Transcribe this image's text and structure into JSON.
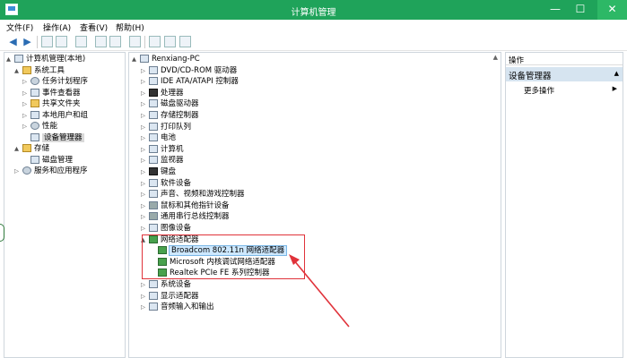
{
  "window": {
    "title": "计算机管理",
    "controls": {
      "minimize": "—",
      "maximize": "☐",
      "close": "✕"
    }
  },
  "menu": [
    "文件(F)",
    "操作(A)",
    "查看(V)",
    "帮助(H)"
  ],
  "left_tree": [
    {
      "label": "计算机管理(本地)",
      "indent": 0,
      "expander": "▲",
      "icon": "computer-icon"
    },
    {
      "label": "系统工具",
      "indent": 1,
      "expander": "▲",
      "icon": "tools-icon"
    },
    {
      "label": "任务计划程序",
      "indent": 2,
      "expander": "▷",
      "icon": "clock-icon"
    },
    {
      "label": "事件查看器",
      "indent": 2,
      "expander": "▷",
      "icon": "event-viewer-icon"
    },
    {
      "label": "共享文件夹",
      "indent": 2,
      "expander": "▷",
      "icon": "folder-icon"
    },
    {
      "label": "本地用户和组",
      "indent": 2,
      "expander": "▷",
      "icon": "users-icon"
    },
    {
      "label": "性能",
      "indent": 2,
      "expander": "▷",
      "icon": "performance-icon"
    },
    {
      "label": "设备管理器",
      "indent": 2,
      "expander": "",
      "icon": "device-manager-icon",
      "selected": true
    },
    {
      "label": "存储",
      "indent": 1,
      "expander": "▲",
      "icon": "storage-icon"
    },
    {
      "label": "磁盘管理",
      "indent": 2,
      "expander": "",
      "icon": "disk-icon"
    },
    {
      "label": "服务和应用程序",
      "indent": 1,
      "expander": "▷",
      "icon": "services-icon"
    }
  ],
  "device_tree": [
    {
      "label": "Renxiang-PC",
      "indent": 0,
      "expander": "▲",
      "icon": "computer-icon"
    },
    {
      "label": "DVD/CD-ROM 驱动器",
      "indent": 1,
      "expander": "▷",
      "icon": "dvd-icon"
    },
    {
      "label": "IDE ATA/ATAPI 控制器",
      "indent": 1,
      "expander": "▷",
      "icon": "ide-icon"
    },
    {
      "label": "处理器",
      "indent": 1,
      "expander": "▷",
      "icon": "processor-icon"
    },
    {
      "label": "磁盘驱动器",
      "indent": 1,
      "expander": "▷",
      "icon": "disk-drive-icon"
    },
    {
      "label": "存储控制器",
      "indent": 1,
      "expander": "▷",
      "icon": "storage-controller-icon"
    },
    {
      "label": "打印队列",
      "indent": 1,
      "expander": "▷",
      "icon": "printer-icon"
    },
    {
      "label": "电池",
      "indent": 1,
      "expander": "▷",
      "icon": "battery-icon"
    },
    {
      "label": "计算机",
      "indent": 1,
      "expander": "▷",
      "icon": "computer-icon"
    },
    {
      "label": "监视器",
      "indent": 1,
      "expander": "▷",
      "icon": "monitor-icon"
    },
    {
      "label": "键盘",
      "indent": 1,
      "expander": "▷",
      "icon": "keyboard-icon"
    },
    {
      "label": "软件设备",
      "indent": 1,
      "expander": "▷",
      "icon": "software-device-icon"
    },
    {
      "label": "声音、视频和游戏控制器",
      "indent": 1,
      "expander": "▷",
      "icon": "sound-icon"
    },
    {
      "label": "鼠标和其他指针设备",
      "indent": 1,
      "expander": "▷",
      "icon": "mouse-icon"
    },
    {
      "label": "通用串行总线控制器",
      "indent": 1,
      "expander": "▷",
      "icon": "usb-icon"
    },
    {
      "label": "图像设备",
      "indent": 1,
      "expander": "▷",
      "icon": "camera-icon"
    },
    {
      "label": "网络适配器",
      "indent": 1,
      "expander": "▲",
      "icon": "network-adapter-icon"
    },
    {
      "label": "Broadcom 802.11n 网络适配器",
      "indent": 2,
      "expander": "",
      "icon": "network-adapter-icon",
      "selected": true
    },
    {
      "label": "Microsoft 内核调试网络适配器",
      "indent": 2,
      "expander": "",
      "icon": "network-adapter-icon"
    },
    {
      "label": "Realtek PCIe FE 系列控制器",
      "indent": 2,
      "expander": "",
      "icon": "network-adapter-icon"
    },
    {
      "label": "系统设备",
      "indent": 1,
      "expander": "▷",
      "icon": "system-device-icon"
    },
    {
      "label": "显示适配器",
      "indent": 1,
      "expander": "▷",
      "icon": "display-adapter-icon"
    },
    {
      "label": "音频输入和输出",
      "indent": 1,
      "expander": "▷",
      "icon": "audio-icon"
    }
  ],
  "actions": {
    "header": "操作",
    "section": "设备管理器",
    "more": "更多操作"
  },
  "colors": {
    "titlebar": "#1fa35a",
    "annotation": "#e0323a",
    "selection": "#cde8ff"
  }
}
